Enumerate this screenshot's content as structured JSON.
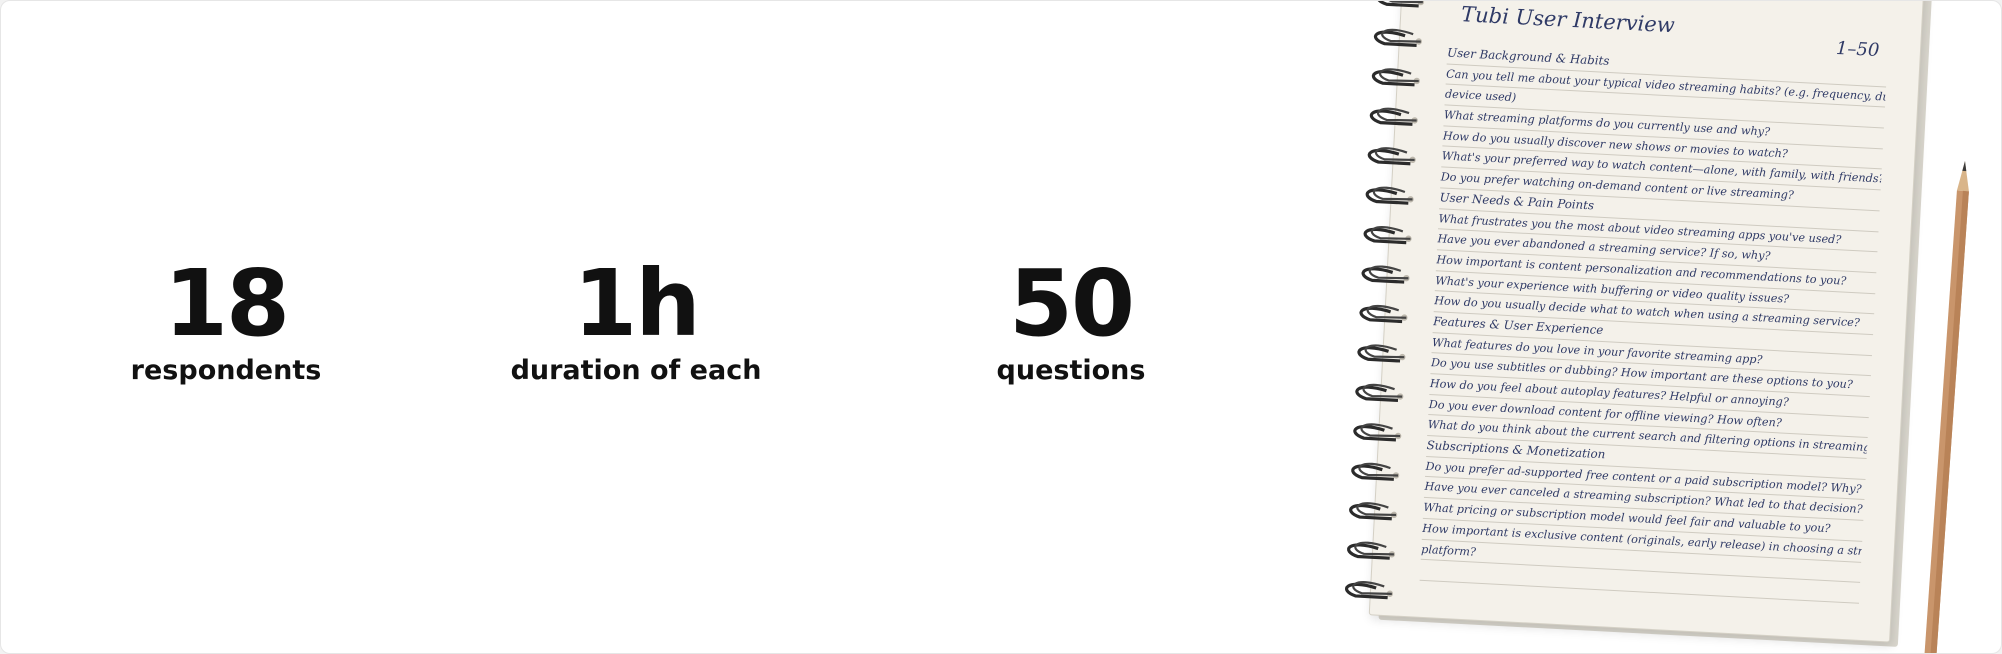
{
  "stats": [
    {
      "value": "18",
      "label": "respondents"
    },
    {
      "value": "1h",
      "label": "duration of each"
    },
    {
      "value": "50",
      "label": "questions"
    }
  ],
  "notebook": {
    "title": "Tubi User Interview",
    "range": "1–50",
    "logo_icon": "play-triangle-logo-icon",
    "ink_color": "#2f3a66",
    "lines": [
      "User Background & Habits",
      "Can you tell me about your typical video streaming habits? (e.g. frequency, duration,",
      "device used)",
      "What streaming platforms do you currently use and why?",
      "How do you usually discover new shows or movies to watch?",
      "What's your preferred way to watch content—alone, with family, with friends?",
      "Do you prefer watching on-demand content or live streaming?",
      "User Needs & Pain Points",
      "What frustrates you the most about video streaming apps you've used?",
      "Have you ever abandoned a streaming service? If so, why?",
      "How important is content personalization and recommendations to you?",
      "What's your experience with buffering or video quality issues?",
      "How do you usually decide what to watch when using a streaming service?",
      "Features & User Experience",
      "What features do you love in your favorite streaming app?",
      "Do you use subtitles or dubbing? How important are these options to you?",
      "How do you feel about autoplay features? Helpful or annoying?",
      "Do you ever download content for offline viewing? How often?",
      "What do you think about the current search and filtering options in streaming apps?",
      "Subscriptions & Monetization",
      "Do you prefer ad-supported free content or a paid subscription model? Why?",
      "Have you ever canceled a streaming subscription? What led to that decision?",
      "What pricing or subscription model would feel fair and valuable to you?",
      "How important is exclusive content (originals, early release) in choosing a streaming",
      "platform?",
      ""
    ]
  },
  "pencil": {
    "icon": "pencil-icon"
  }
}
